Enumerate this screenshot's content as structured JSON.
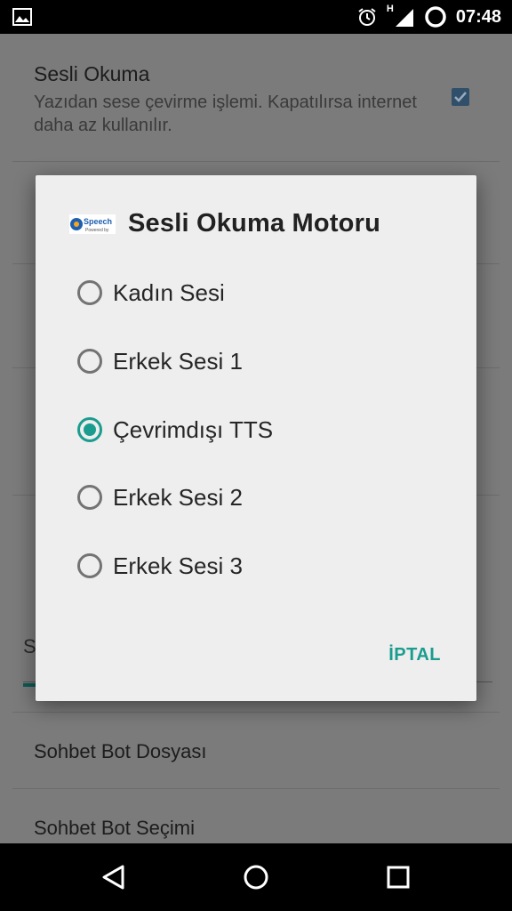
{
  "status_bar": {
    "network_label": "H",
    "time": "07:48"
  },
  "background": {
    "pref_title": "Sesli Okuma",
    "pref_summary": "Yazıdan sese çevirme işlemi. Kapatılırsa internet daha az kullanılır.",
    "pref_checked": true,
    "section_letter": "S",
    "item_chat_file": "Sohbet Bot Dosyası",
    "item_chat_select": "Sohbet Bot Seçimi"
  },
  "dialog": {
    "logo_text": "Speech",
    "logo_subtext": "Powered by",
    "title": "Sesli Okuma Motoru",
    "options": [
      {
        "label": "Kadın Sesi",
        "checked": false
      },
      {
        "label": "Erkek Sesi 1",
        "checked": false
      },
      {
        "label": "Çevrimdışı TTS",
        "checked": true
      },
      {
        "label": "Erkek Sesi 2",
        "checked": false
      },
      {
        "label": "Erkek Sesi 3",
        "checked": false
      }
    ],
    "cancel_label": "İPTAL"
  },
  "colors": {
    "accent": "#1a9c8e",
    "status_bar": "#000000",
    "dialog_bg": "#eeeeee"
  }
}
